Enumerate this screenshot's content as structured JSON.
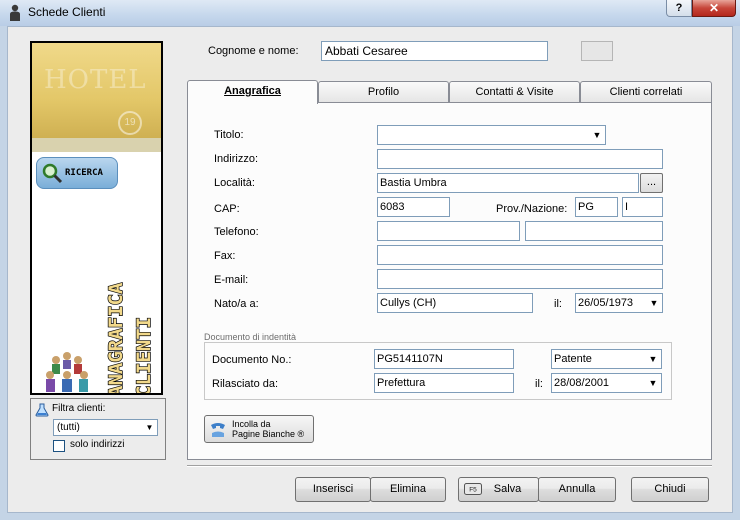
{
  "window": {
    "title": "Schede Clienti",
    "help_label": "?",
    "close_label": "✕"
  },
  "banner": {
    "hotel_text": "HOTEL",
    "hotel_logo_text": "19",
    "search_button": "RICERCA",
    "vertical_text_1": "ANAGRAFICA",
    "vertical_text_2": "CLIENTI"
  },
  "filter": {
    "label": "Filtra clienti:",
    "value": "(tutti)",
    "checkbox_label": "solo indirizzi"
  },
  "client_name": {
    "label": "Cognome e nome:",
    "value": "Abbati Cesaree"
  },
  "tabs": [
    {
      "label": "Anagrafica",
      "active": true
    },
    {
      "label": "Profilo"
    },
    {
      "label": "Contatti & Visite"
    },
    {
      "label": "Clienti correlati"
    }
  ],
  "form": {
    "titolo_label": "Titolo:",
    "titolo_value": "",
    "indirizzo_label": "Indirizzo:",
    "indirizzo_value": "",
    "localita_label": "Località:",
    "localita_value": "Bastia Umbra",
    "localita_button": "...",
    "cap_label": "CAP:",
    "cap_value": "6083",
    "prov_label": "Prov./Nazione:",
    "prov_value": "PG",
    "nazione_value": "I",
    "telefono_label": "Telefono:",
    "telefono_value_1": "",
    "telefono_value_2": "",
    "fax_label": "Fax:",
    "fax_value": "",
    "email_label": "E-mail:",
    "email_value": "",
    "nato_label": "Nato/a a:",
    "nato_value": "Cullys (CH)",
    "nato_date_label": "il:",
    "nato_date_value": "26/05/1973"
  },
  "documento": {
    "group_title": "Documento di indentità",
    "numero_label": "Documento  No.:",
    "numero_value": "PG5141107N",
    "tipo_value": "Patente",
    "rilasciato_label": "Rilasciato da:",
    "rilasciato_value": "Prefettura",
    "data_label": "il:",
    "data_value": "28/08/2001"
  },
  "incolla_button": {
    "line1": "Incolla da",
    "line2": "Pagine Bianche ®"
  },
  "buttons": {
    "inserisci": "Inserisci",
    "elimina": "Elimina",
    "salva": "Salva",
    "salva_key": "F5",
    "annulla": "Annulla",
    "chiudi": "Chiudi"
  }
}
